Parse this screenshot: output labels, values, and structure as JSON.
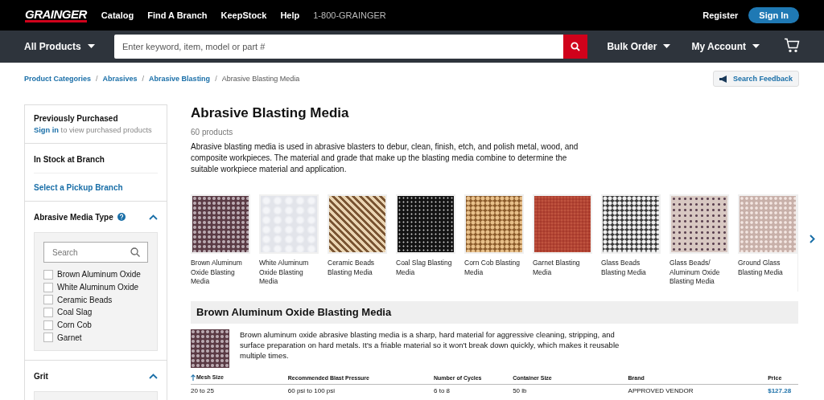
{
  "header": {
    "logo": "GRAINGER",
    "links": [
      "Catalog",
      "Find A Branch",
      "KeepStock",
      "Help"
    ],
    "phone": "1-800-GRAINGER",
    "register": "Register",
    "sign_in": "Sign In"
  },
  "navbar": {
    "all_products": "All Products",
    "search": {
      "placeholder": "Enter keyword, item, model or part #"
    },
    "bulk_order": "Bulk Order",
    "my_account": "My Account"
  },
  "breadcrumb": {
    "links": [
      "Product Categories",
      "Abrasives",
      "Abrasive Blasting"
    ],
    "current": "Abrasive Blasting Media",
    "separator": "/"
  },
  "search_feedback": "Search Feedback",
  "sidebar": {
    "previously_purchased": {
      "title": "Previously Purchased",
      "link": "Sign in",
      "text": "to view purchased products"
    },
    "in_stock": {
      "title": "In Stock at Branch",
      "link": "Select a Pickup Branch"
    },
    "filters": [
      {
        "title": "Abrasive Media Type",
        "help": true,
        "expanded": true,
        "search": {
          "placeholder": "Search"
        },
        "options": [
          {
            "label": "Brown Aluminum Oxide",
            "checked": false
          },
          {
            "label": "White Aluminum Oxide",
            "checked": false
          },
          {
            "label": "Ceramic Beads",
            "checked": false
          },
          {
            "label": "Coal Slag",
            "checked": false
          },
          {
            "label": "Corn Cob",
            "checked": false
          },
          {
            "label": "Garnet",
            "checked": false
          }
        ]
      },
      {
        "title": "Grit",
        "help": false,
        "expanded": true
      }
    ]
  },
  "main": {
    "title": "Abrasive Blasting Media",
    "count": "60 products",
    "description": "Abrasive blasting media is used in abrasive blasters to debur, clean, finish, etch, and polish metal, wood, and composite workpieces. The material and grade that make up the blasting media combine to determine the suitable workpiece material and application.",
    "categories": [
      {
        "label": "Brown Aluminum Oxide Blasting Media"
      },
      {
        "label": "White Aluminum Oxide Blasting Media"
      },
      {
        "label": "Ceramic Beads Blasting Media"
      },
      {
        "label": "Coal Slag Blasting Media"
      },
      {
        "label": "Corn Cob Blasting Media"
      },
      {
        "label": "Garnet Blasting Media"
      },
      {
        "label": "Glass Beads Blasting Media"
      },
      {
        "label": "Glass Beads/ Aluminum Oxide Blasting Media"
      },
      {
        "label": "Ground Glass Blasting Media"
      }
    ],
    "section": {
      "title": "Brown Aluminum Oxide Blasting Media",
      "description": "Brown aluminum oxide abrasive blasting media is a sharp, hard material for aggressive cleaning, stripping, and surface preparation on hard metals. It's a friable material so it won't break down quickly, which makes it reusable multiple times.",
      "table": {
        "columns": [
          "Mesh Size",
          "Recommended Blast Pressure",
          "Number of Cycles",
          "Container Size",
          "Brand",
          "Price"
        ],
        "rows": [
          [
            "20 to 25",
            "60 psi to 100 psi",
            "6 to 8",
            "50 lb",
            "APPROVED VENDOR",
            "$127.28"
          ]
        ]
      }
    }
  }
}
